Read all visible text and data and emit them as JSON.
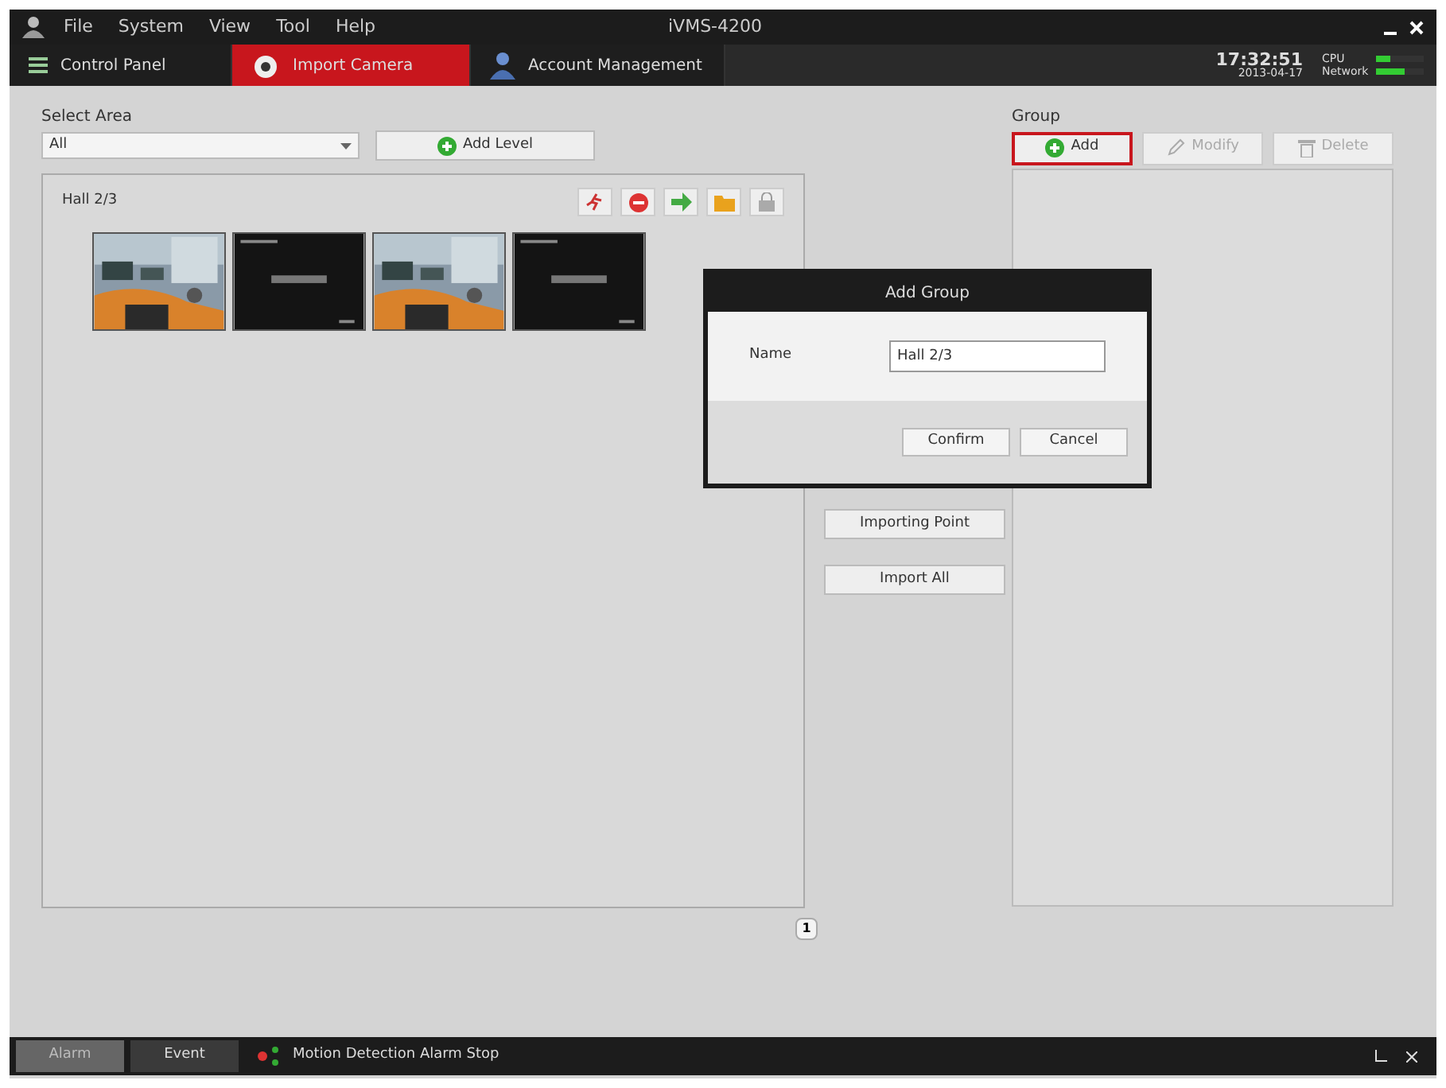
{
  "window": {
    "title": "iVMS-4200"
  },
  "menu": [
    "File",
    "System",
    "View",
    "Tool",
    "Help"
  ],
  "tabs": [
    {
      "label": "Control Panel",
      "selected": false,
      "kind": "panel"
    },
    {
      "label": "Import Camera",
      "selected": true,
      "kind": "camera"
    },
    {
      "label": "Account Management",
      "selected": false,
      "kind": "account"
    }
  ],
  "clock": {
    "time": "17:32:51",
    "date": "2013-04-17"
  },
  "meters": [
    {
      "label": "CPU",
      "level": 0.3
    },
    {
      "label": "Network",
      "level": 0.6
    }
  ],
  "area": {
    "label": "Select Area",
    "select": "All",
    "add_button": "Add Level"
  },
  "camera_panel": {
    "title": "Hall 2/3",
    "tools": [
      {
        "kind": "run"
      },
      {
        "kind": "stop"
      },
      {
        "kind": "go"
      },
      {
        "kind": "folder"
      },
      {
        "kind": "lock"
      }
    ],
    "thumbnails": [
      {
        "kind": "live"
      },
      {
        "kind": "blank"
      },
      {
        "kind": "live"
      },
      {
        "kind": "blank"
      }
    ]
  },
  "middle_buttons": [
    "Importing Point",
    "Import All"
  ],
  "group": {
    "label": "Group",
    "buttons": [
      {
        "label": "Add",
        "kind": "add",
        "selected": true
      },
      {
        "label": "Modify",
        "kind": "modify",
        "selected": false
      },
      {
        "label": "Delete",
        "kind": "delete",
        "selected": false
      }
    ]
  },
  "page": "1",
  "dialog": {
    "title": "Add Group",
    "field_label": "Name",
    "field_value": "Hall 2/3",
    "buttons": [
      "Confirm",
      "Cancel"
    ]
  },
  "status_bar": {
    "tabs": [
      {
        "label": "Alarm",
        "selected": true
      },
      {
        "label": "Event",
        "selected": false
      }
    ],
    "message": "Motion Detection Alarm Stop"
  }
}
